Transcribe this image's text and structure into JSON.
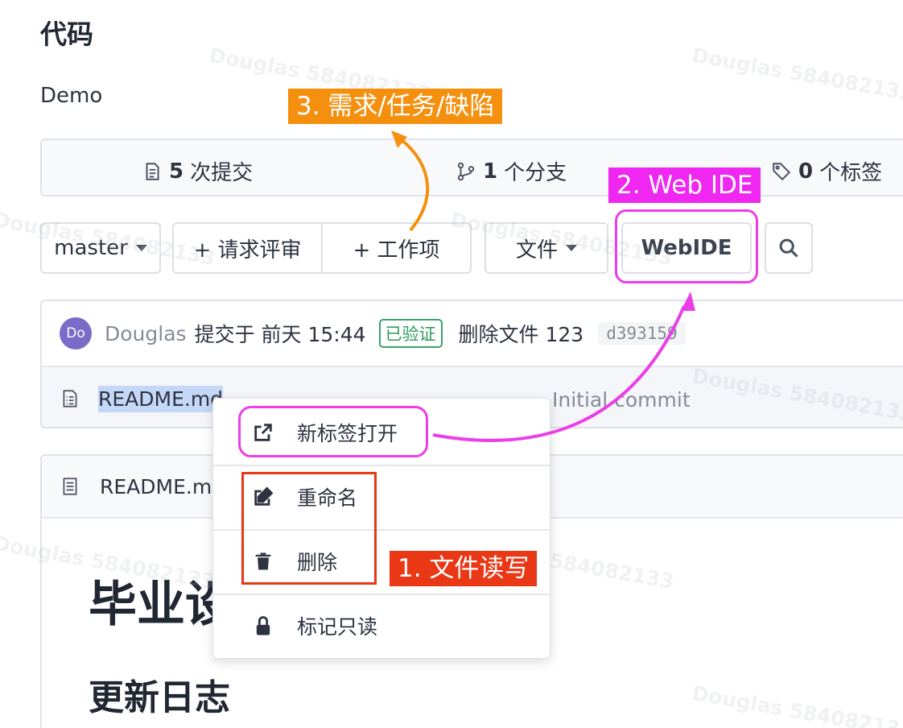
{
  "page": {
    "title": "代码",
    "repo_name": "Demo"
  },
  "stats": {
    "commits_count": "5",
    "commits_label": "次提交",
    "branches_count": "1",
    "branches_label": "个分支",
    "tags_count": "0",
    "tags_label": "个标签"
  },
  "toolbar": {
    "branch": "master",
    "review_request": "+ 请求评审",
    "work_item": "+ 工作项",
    "file_menu": "文件",
    "webide": "WebIDE"
  },
  "commit": {
    "avatar_initials": "Do",
    "author": "Douglas",
    "time": "提交于 前天 15:44",
    "verified": "已验证",
    "message": "删除文件 123",
    "sha": "d393159"
  },
  "files": [
    {
      "name": "README.md",
      "last_commit": "Initial commit"
    }
  ],
  "readme": {
    "file_name": "README.m",
    "h1": "毕业设",
    "h2": "更新日志"
  },
  "context_menu": {
    "open_new_tab": "新标签打开",
    "rename": "重命名",
    "delete": "删除",
    "mark_readonly": "标记只读"
  },
  "annotations": {
    "file_rw": "1. 文件读写",
    "web_ide": "2. Web IDE",
    "requirements": "3. 需求/任务/缺陷"
  },
  "watermark": "Douglas 584082133",
  "colors": {
    "annotation_orange": "#f5900f",
    "annotation_magenta": "#ec3ee8",
    "annotation_red": "#ea3716",
    "verified_green": "#2f9b5e",
    "avatar_purple": "#7b6bc8",
    "selection_blue": "#c5d7f6"
  }
}
